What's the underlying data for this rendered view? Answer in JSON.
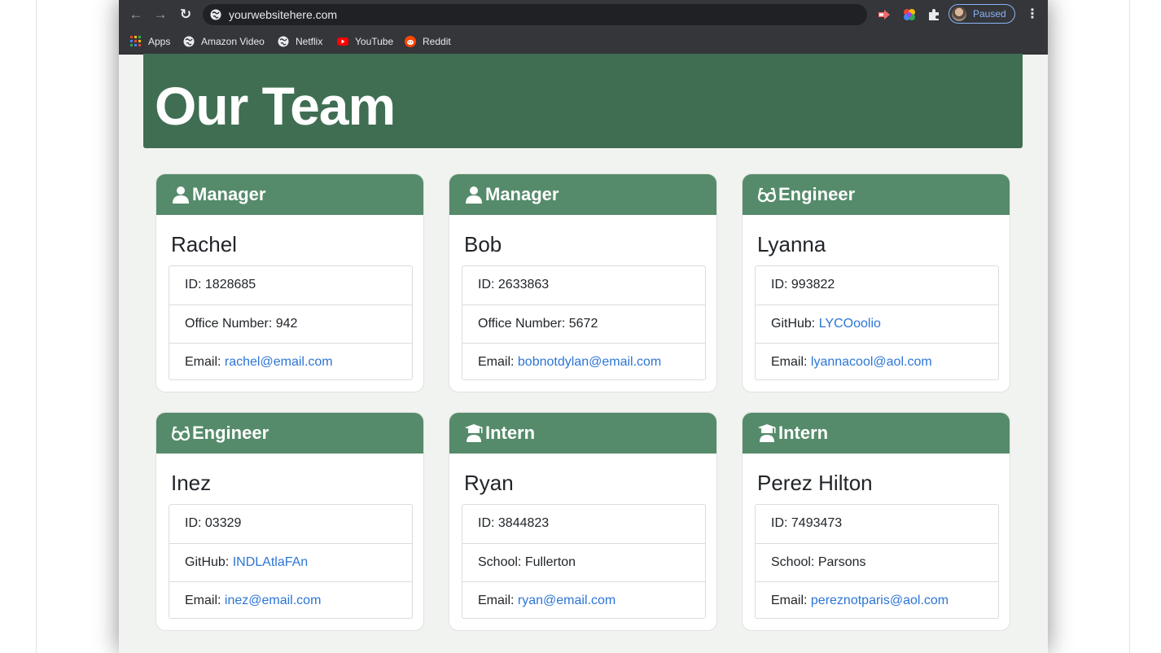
{
  "browser": {
    "url": "yourwebsitehere.com",
    "profile_status": "Paused",
    "bookmarks": [
      {
        "label": "Apps",
        "icon": "apps-grid-icon"
      },
      {
        "label": "Amazon Video",
        "icon": "globe-icon"
      },
      {
        "label": "Netflix",
        "icon": "globe-icon"
      },
      {
        "label": "YouTube",
        "icon": "youtube-icon"
      },
      {
        "label": "Reddit",
        "icon": "reddit-icon"
      }
    ]
  },
  "colors": {
    "hero": "#3f6e53",
    "card_header": "#558b6a",
    "link": "#2c75d6"
  },
  "page": {
    "title": "Our Team"
  },
  "team": [
    {
      "role": "Manager",
      "icon": "user-icon",
      "name": "Rachel",
      "id": "1828685",
      "detail_label": "Office Number:",
      "detail_value": "942",
      "email": "rachel@email.com"
    },
    {
      "role": "Manager",
      "icon": "user-icon",
      "name": "Bob",
      "id": "2633863",
      "detail_label": "Office Number:",
      "detail_value": "5672",
      "email": "bobnotdylan@email.com"
    },
    {
      "role": "Engineer",
      "icon": "glasses-icon",
      "name": "Lyanna",
      "id": "993822",
      "detail_label": "GitHub:",
      "detail_value": "LYCOoolio",
      "email": "lyannacool@aol.com"
    },
    {
      "role": "Engineer",
      "icon": "glasses-icon",
      "name": "Inez",
      "id": "03329",
      "detail_label": "GitHub:",
      "detail_value": "INDLAtlaFAn",
      "email": "inez@email.com"
    },
    {
      "role": "Intern",
      "icon": "graduate-icon",
      "name": "Ryan",
      "id": "3844823",
      "detail_label": "School:",
      "detail_value": "Fullerton",
      "email": "ryan@email.com"
    },
    {
      "role": "Intern",
      "icon": "graduate-icon",
      "name": "Perez Hilton",
      "id": "7493473",
      "detail_label": "School:",
      "detail_value": "Parsons",
      "email": "pereznotparis@aol.com"
    }
  ],
  "labels": {
    "id": "ID:",
    "email": "Email:"
  }
}
